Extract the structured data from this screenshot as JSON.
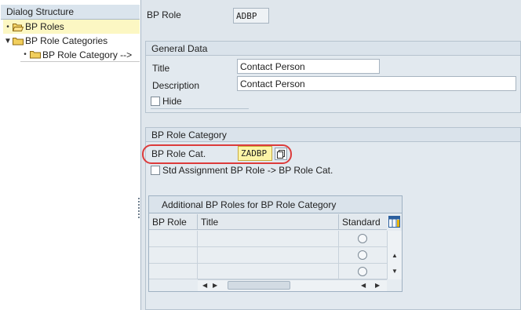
{
  "dialog_structure": {
    "title": "Dialog Structure",
    "items": [
      {
        "label": "BP Roles",
        "level": 0,
        "selected": true
      },
      {
        "label": "BP Role Categories",
        "level": 0,
        "expanded": true
      },
      {
        "label": "BP Role Category -->",
        "level": 1
      }
    ]
  },
  "header": {
    "bp_role_label": "BP Role",
    "bp_role_value": "ADBP"
  },
  "general_data": {
    "title": "General Data",
    "title_label": "Title",
    "title_value": "Contact Person",
    "description_label": "Description",
    "description_value": "Contact Person",
    "hide_label": "Hide",
    "hide_checked": false
  },
  "role_category": {
    "title": "BP Role Category",
    "cat_label": "BP Role Cat.",
    "cat_value": "ZADBP",
    "std_label": "Std Assignment BP Role -> BP Role Cat.",
    "std_checked": false
  },
  "table": {
    "title": "Additional BP Roles for BP Role Category",
    "columns": [
      "BP Role",
      "Title",
      "Standard"
    ],
    "rows": [
      {
        "bp_role": "",
        "title": "",
        "standard": false
      },
      {
        "bp_role": "",
        "title": "",
        "standard": false
      },
      {
        "bp_role": "",
        "title": "",
        "standard": false
      }
    ]
  },
  "colors": {
    "selected_row": "#fcf7c3",
    "highlight_border": "#dc3b3b",
    "input_highlight": "#fdf5a7"
  }
}
